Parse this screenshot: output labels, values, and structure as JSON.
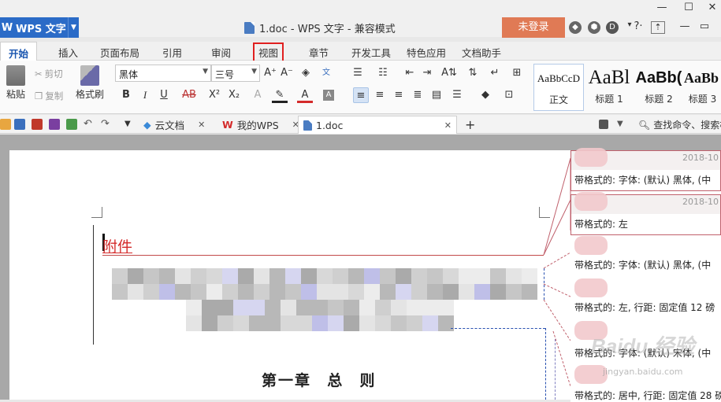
{
  "app": {
    "name": "WPS 文字",
    "logo_glyph": "W"
  },
  "window": {
    "title": "1.doc - WPS 文字 - 兼容模式",
    "login_label": "未登录"
  },
  "tabs": [
    {
      "label": "开始",
      "active": true
    },
    {
      "label": "插入"
    },
    {
      "label": "页面布局"
    },
    {
      "label": "引用"
    },
    {
      "label": "审阅"
    },
    {
      "label": "视图",
      "highlighted": true
    },
    {
      "label": "章节"
    },
    {
      "label": "开发工具"
    },
    {
      "label": "特色应用"
    },
    {
      "label": "文档助手"
    }
  ],
  "ribbon": {
    "paste_label": "粘贴",
    "cut_label": "剪切",
    "copy_label": "复制",
    "format_painter_label": "格式刷",
    "font_name": "黑体",
    "font_size": "三号",
    "styles": [
      {
        "sample": "AaBbCcD",
        "label": "正文"
      },
      {
        "sample": "AaBl",
        "label": "标题 1"
      },
      {
        "sample": "AaBb(",
        "label": "标题 2"
      },
      {
        "sample": "AaBb",
        "label": "标题 3"
      }
    ]
  },
  "quickbar": {
    "doc_tabs": [
      {
        "label": "云文档"
      },
      {
        "label": "我的WPS"
      },
      {
        "label": "1.doc",
        "active": true
      }
    ],
    "search_label": "查找命令、搜索模"
  },
  "document": {
    "attachment_heading": "附件",
    "chapter_heading": "第一章   总   则"
  },
  "comments": [
    {
      "date": "2018-10",
      "text": "带格式的: 字体: (默认) 黑体, (中"
    },
    {
      "date": "2018-10",
      "text": "带格式的: 左"
    },
    {
      "text": "带格式的: 字体: (默认) 黑体, (中"
    },
    {
      "text": "带格式的: 左, 行距: 固定值 12 磅"
    },
    {
      "text": "带格式的: 字体: (默认) 宋体, (中"
    },
    {
      "text": "带格式的: 居中, 行距: 固定值 28 磅"
    }
  ],
  "watermark": {
    "brand": "Baidu 经验",
    "url": "jingyan.baidu.com"
  },
  "colors": {
    "accent": "#2b6bc7",
    "login": "#e07a55",
    "revision": "#c0606c",
    "heading": "#d42a2a"
  }
}
